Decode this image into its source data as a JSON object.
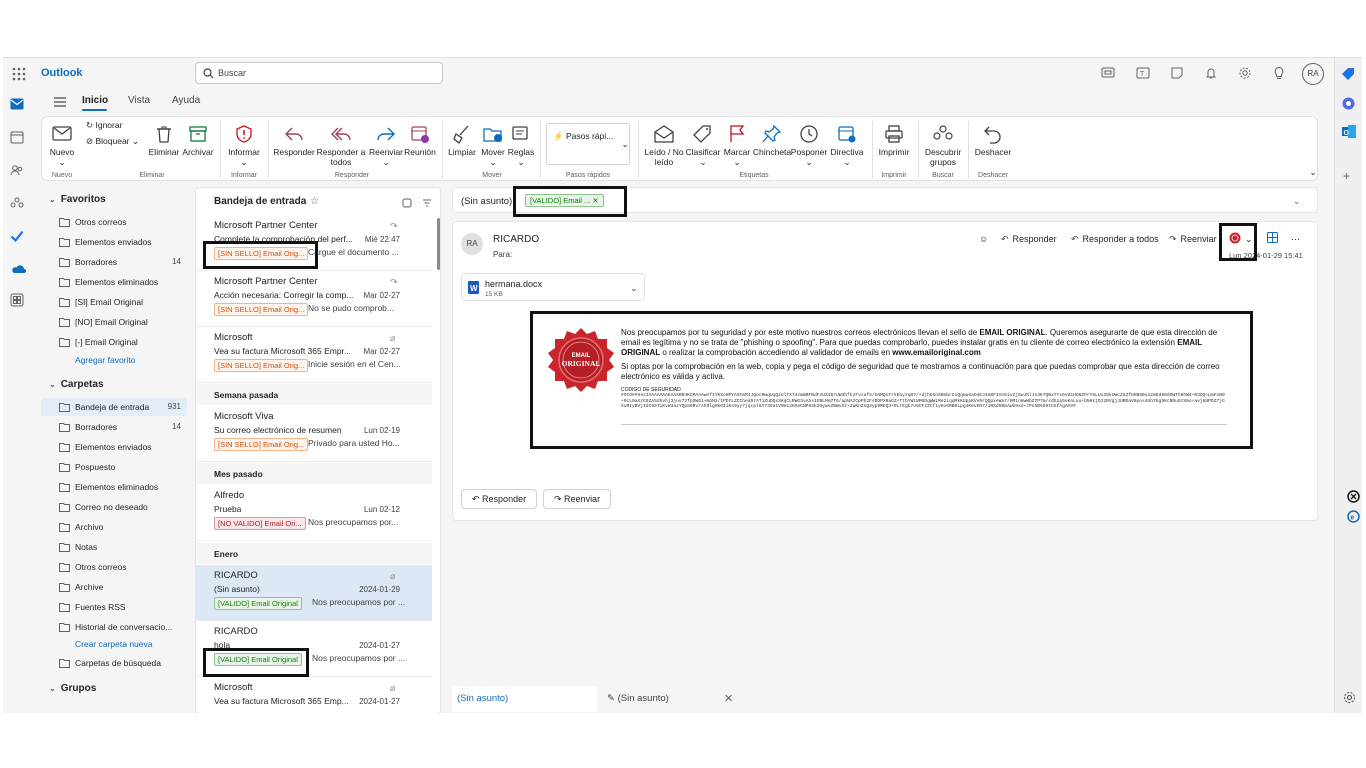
{
  "app": {
    "brand": "Outlook",
    "search_placeholder": "Buscar",
    "avatar_initials": "RA"
  },
  "tabs": [
    "Inicio",
    "Vista",
    "Ayuda"
  ],
  "ribbon": {
    "nuevo": "Nuevo",
    "ignorar": "Ignorar",
    "bloquear": "Bloquear",
    "eliminar": "Eliminar",
    "archivar": "Archivar",
    "informar": "Informar",
    "responder": "Responder",
    "responder_todos": "Responder a todos",
    "reenviar": "Reenviar",
    "reunion": "Reunión",
    "limpiar": "Limpiar",
    "mover": "Mover",
    "reglas": "Reglas",
    "pasos_rapidos": "Pasos rápi...",
    "leido": "Leído / No leído",
    "clasificar": "Clasificar",
    "marcar": "Marcar",
    "chincheta": "Chincheta",
    "posponer": "Posponer",
    "directiva": "Directiva",
    "imprimir": "Imprimir",
    "descubrir": "Descubrir grupos",
    "deshacer": "Deshacer",
    "groups": [
      "Nuevo",
      "Eliminar",
      "Informar",
      "Responder",
      "Mover",
      "Pasos rápidos",
      "Etiquetas",
      "Imprimir",
      "Buscar",
      "Deshacer"
    ]
  },
  "folders": {
    "favoritos_title": "Favoritos",
    "favoritos": [
      {
        "label": "Otros correos",
        "count": ""
      },
      {
        "label": "Elementos enviados",
        "count": ""
      },
      {
        "label": "Borradores",
        "count": "14"
      },
      {
        "label": "Elementos eliminados",
        "count": ""
      },
      {
        "label": "[SI] Email Original",
        "count": ""
      },
      {
        "label": "[NO] Email Original",
        "count": ""
      },
      {
        "label": "[-] Email Original",
        "count": ""
      }
    ],
    "agregar_favorito": "Agregar favorito",
    "carpetas_title": "Carpetas",
    "carpetas": [
      {
        "label": "Bandeja de entrada",
        "count": "931"
      },
      {
        "label": "Borradores",
        "count": "14"
      },
      {
        "label": "Elementos enviados",
        "count": ""
      },
      {
        "label": "Pospuesto",
        "count": ""
      },
      {
        "label": "Elementos eliminados",
        "count": ""
      },
      {
        "label": "Correo no deseado",
        "count": ""
      },
      {
        "label": "Archivo",
        "count": ""
      },
      {
        "label": "Notas",
        "count": ""
      },
      {
        "label": "Otros correos",
        "count": ""
      },
      {
        "label": "Archive",
        "count": ""
      },
      {
        "label": "Fuentes RSS",
        "count": ""
      },
      {
        "label": "Historial de conversacio...",
        "count": ""
      }
    ],
    "crear_carpeta": "Crear carpeta nueva",
    "carpetas_busqueda": "Carpetas de búsqueda",
    "grupos_title": "Grupos"
  },
  "message_list": {
    "title": "Bandeja de entrada",
    "messages": [
      {
        "sender": "Microsoft Partner Center",
        "subject": "Complete la comprobación del perf...",
        "date": "Mié 22:47",
        "tag": "[SIN SELLO] Email Orig...",
        "preview": "Cargue el documento ..."
      },
      {
        "sender": "Microsoft Partner Center",
        "subject": "Acción necesaria: Corregir la comp...",
        "date": "Mar 02-27",
        "tag": "[SIN SELLO] Email Orig...",
        "preview": "No se pudo comprob..."
      },
      {
        "sender": "Microsoft",
        "subject": "Vea su factura Microsoft 365 Empr...",
        "date": "Mar 02-27",
        "tag": "[SIN SELLO] Email Orig...",
        "preview": "Inicie sesión en el Cen..."
      },
      {
        "sender": "Microsoft Viva",
        "subject": "Su correo electrónico de resumen",
        "date": "Lun 02-19",
        "tag": "[SIN SELLO] Email Orig...",
        "preview": "Privado para usted Ho..."
      },
      {
        "sender": "Alfredo",
        "subject": "Prueba",
        "date": "Lun 02-12",
        "tag": "[NO VALIDO] Email Ori...",
        "preview": "Nos preocupamos por..."
      },
      {
        "sender": "RICARDO",
        "subject": "(Sin asunto)",
        "date": "2024-01-29",
        "tag": "[VALIDO] Email Original",
        "preview": "Nos preocupamos por ..."
      },
      {
        "sender": "RICARDO",
        "subject": "hola",
        "date": "2024-01-27",
        "tag": "[VALIDO] Email Original",
        "preview": "Nos preocupamos por ..."
      },
      {
        "sender": "Microsoft",
        "subject": "Vea su factura Microsoft 365 Emp...",
        "date": "2024-01-27",
        "tag": "",
        "preview": ""
      }
    ],
    "sections": [
      "Semana pasada",
      "Mes pasado",
      "Enero"
    ]
  },
  "reading": {
    "subject": "(Sin asunto)",
    "subject_tag": "[VALIDO] Email ...",
    "sender": "RICARDO",
    "sender_initials": "RA",
    "to_label": "Para:",
    "actions": {
      "reply": "Responder",
      "reply_all": "Responder a todos",
      "forward": "Reenviar"
    },
    "date": "Lun 2024-01-29 15:41",
    "attachment": {
      "name": "hermana.docx",
      "size": "15 KB"
    },
    "seal_text_1a": "Nos preocupamos por tu seguridad y por este motivo nuestros correos electrónicos llevan el sello de ",
    "seal_text_1b": "EMAIL ORIGINAL",
    "seal_text_1c": ". Queremos asegurarte de que esta dirección de email es legítima y no se trata de \"phishing o spoofing\". Para que puedas comprobarlo, puedes instalar gratis en tu cliente de correo electrónico la extensión ",
    "seal_text_1d": "EMAIL ORIGINAL",
    "seal_text_1e": " o realizar la comprobación accediendo al validador de emails en ",
    "seal_text_1f": "www.emailoriginal.com",
    "seal_text_2": "Si optas por la comprobación en la web, copia y pega el código de seguridad que te mostramos a continuación para que puedas comprobar que esta dirección de correo electrónico es válida y activa.",
    "code_label": "CODIGO DE SEGURIDAD",
    "code": "##CO##H4sIAAAAAAAEAAXBR4KCMAAAwAfIYKSoHPYASFmMJJQocMwqUqQiUlTX74zmWBFBdFnUX1DrUW3hfkzFvsafS/G6MQsFrkEbyzq07/+djhDXnSKmbrC1Qqmu6aO4EJ4m0FIAn5iuZjSwJNlJs3K7QBxYYx6V61HO6ZPrY5LUx39kUWc2kZfHHB8Bu12mDd80dOWTh8hW4+R3OQ+pmFoB0+9cL0aXzG0ZA5d5vhj3juv72fpSW6i+m6N3/1PDYLZCChed5rATiZuDQs3KqCLRWG3vAhs1EBLMm7T6/apNAICpPh2FsDDPXRaGZ+TtbYW1NM6DqWWiMe2iqqMkKUppKVvRrQQpxeWa7/HMinHwWbZ7P7m/sdh1p5eKnLau+bNHkjDz2RVgjJURDaV8pos4Uh7bg9KcNRu5YXmo+avj88PDZ7jGXuRIyBVjIdC65TiKvW3azYQp89RvrshOlgHK0IiKs9yy7jqcpl5Y739u1V9m13HXeCNP6Sk2OywsZBWvSz+2wKnZnQ4yp9MEQ3+RLrEgb7v0CFzZtf1y8o6RB0Lpg4K6vKN7/1RXd5B6Awb9xd+rPn5B659tCGfAgAA##"
  },
  "bottom_tabs": {
    "tab1": "(Sin asunto)",
    "tab2": "(Sin asunto)"
  },
  "colors": {
    "accent": "#0f6cbd",
    "seal_red": "#c8262c"
  }
}
